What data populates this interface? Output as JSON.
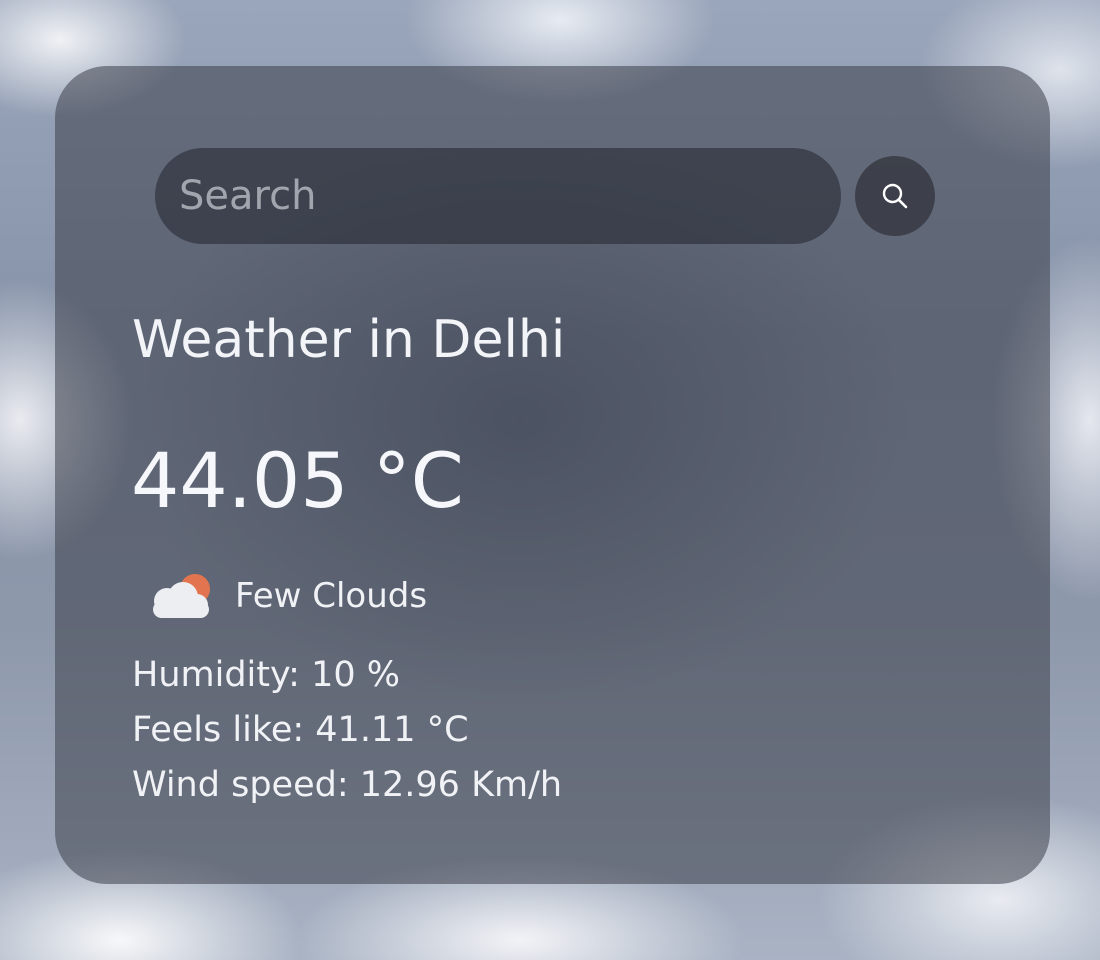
{
  "search": {
    "placeholder": "Search",
    "value": "",
    "button_icon": "search-icon"
  },
  "weather": {
    "title": "Weather in Delhi",
    "temperature": "44.05 °C",
    "condition_icon": "few-clouds-icon",
    "condition": "Few Clouds",
    "humidity": "Humidity: 10 %",
    "feels_like": "Feels like: 41.11 °C",
    "wind_speed": "Wind speed: 12.96 Km/h"
  },
  "colors": {
    "card_background": "#3c404a",
    "text": "#f2f4f8",
    "sun": "#e2754f"
  }
}
